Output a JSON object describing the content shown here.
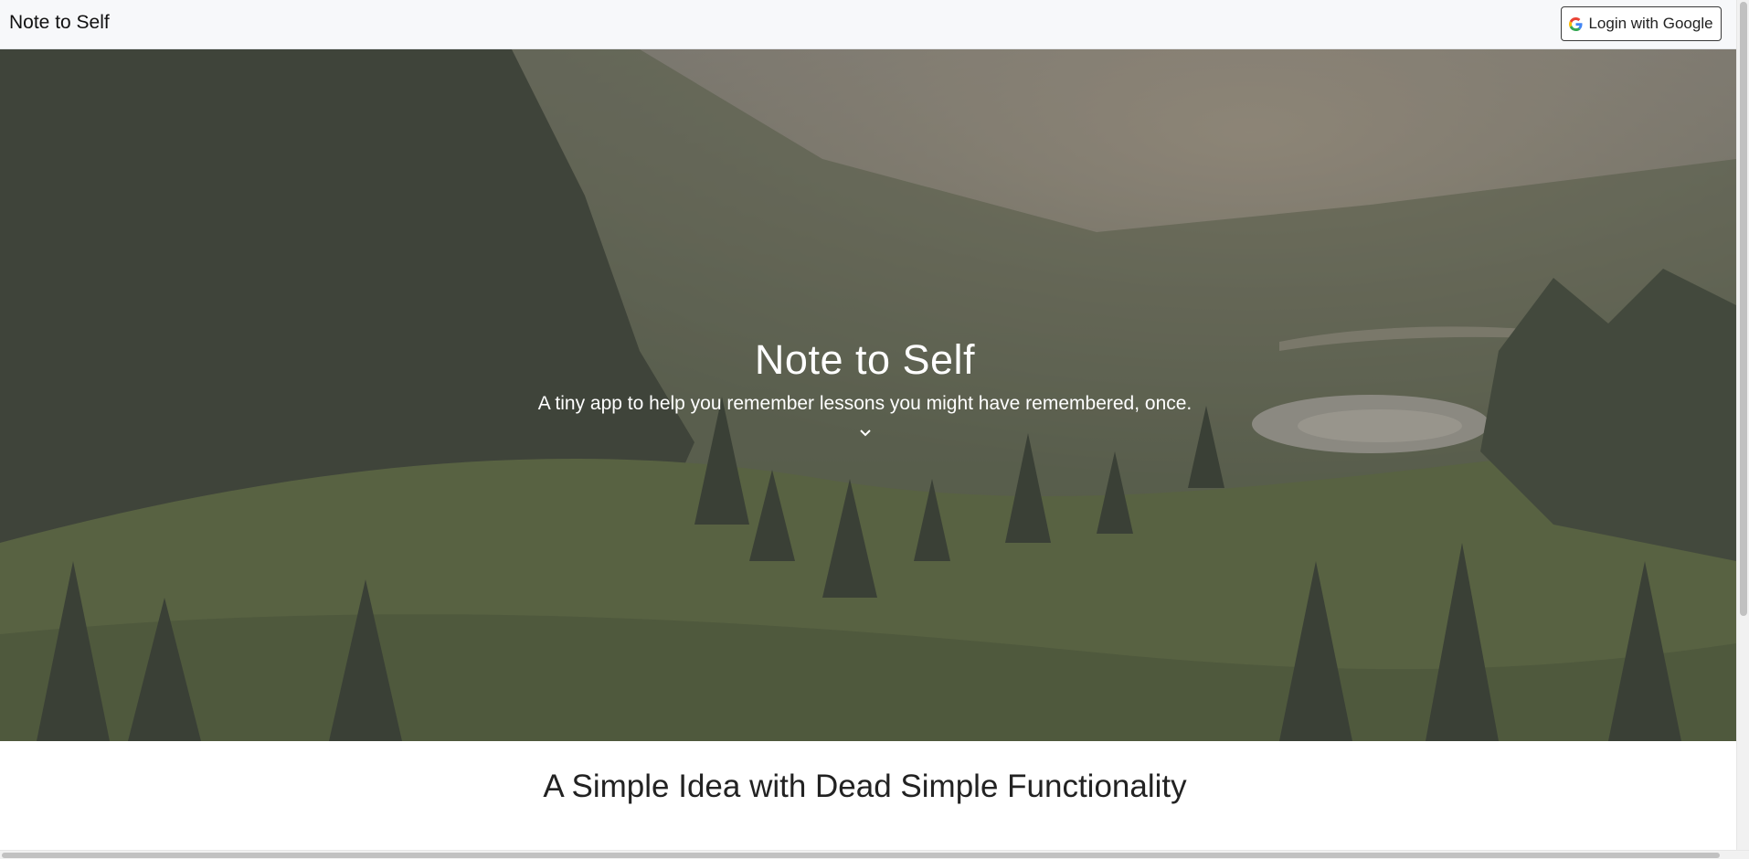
{
  "navbar": {
    "brand": "Note to Self",
    "login_label": "Login with Google"
  },
  "hero": {
    "title": "Note to Self",
    "subtitle": "A tiny app to help you remember lessons you might have remembered, once."
  },
  "section": {
    "title": "A Simple Idea with Dead Simple Functionality"
  },
  "icons": {
    "login": "google-icon",
    "scroll": "chevron-down-icon"
  },
  "colors": {
    "navbar_bg": "#f7f8fa",
    "hero_overlay": "#555555",
    "text_light": "#ffffff",
    "text_dark": "#222222"
  }
}
